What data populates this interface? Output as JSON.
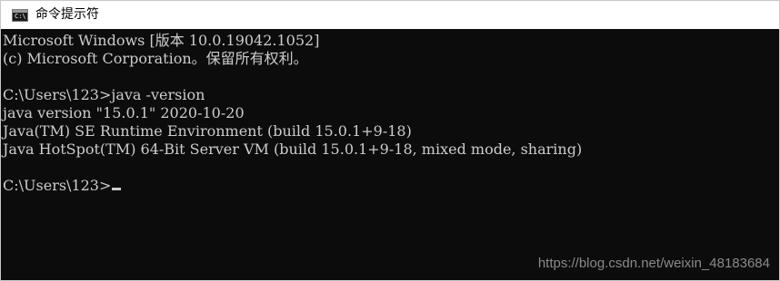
{
  "window": {
    "title": "命令提示符",
    "icon": "cmd-icon",
    "icon_prompt": "C:\\"
  },
  "console": {
    "lines": [
      "Microsoft Windows [版本 10.0.19042.1052]",
      "(c) Microsoft Corporation。保留所有权利。",
      "",
      "C:\\Users\\123>java -version",
      "java version \"15.0.1\" 2020-10-20",
      "Java(TM) SE Runtime Environment (build 15.0.1+9-18)",
      "Java HotSpot(TM) 64-Bit Server VM (build 15.0.1+9-18, mixed mode, sharing)",
      ""
    ],
    "prompt": "C:\\Users\\123>"
  },
  "watermark": "https://blog.csdn.net/weixin_48183684",
  "colors": {
    "console_bg": "#0c0c0c",
    "console_text": "#cccccc",
    "titlebar_bg": "#ffffff"
  }
}
